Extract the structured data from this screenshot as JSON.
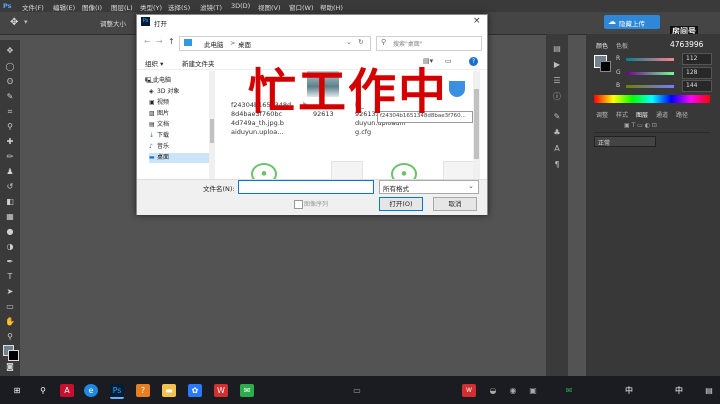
{
  "menu": {
    "items": [
      "Ps",
      "文件(F)",
      "编辑(E)",
      "图像(I)",
      "图层(L)",
      "类型(Y)",
      "选择(S)",
      "滤镜(T)",
      "3D(D)",
      "视图(V)",
      "窗口(W)",
      "帮助(H)"
    ]
  },
  "options": {
    "adjust_label": "调整大小"
  },
  "dialog": {
    "title": "打开",
    "address": {
      "root": "此电脑",
      "sep": ">",
      "folder": "桌面"
    },
    "search_placeholder": "搜索\"桌面\"",
    "organize": "组织",
    "new_folder": "新建文件夹",
    "nav": [
      {
        "icon": "pc",
        "label": "此电脑"
      },
      {
        "icon": "3d",
        "label": "3D 对象"
      },
      {
        "icon": "video",
        "label": "视频"
      },
      {
        "icon": "pic",
        "label": "图片"
      },
      {
        "icon": "doc",
        "label": "文档"
      },
      {
        "icon": "down",
        "label": "下载"
      },
      {
        "icon": "music",
        "label": "音乐"
      },
      {
        "icon": "desk",
        "label": "桌面"
      }
    ],
    "files": [
      {
        "lines": [
          "f24304b1651348d",
          "8d4bae3f760bc",
          "4d749a_th.jpg.b",
          "aiduyun.uploa..."
        ]
      },
      {
        "lines": [
          "b_",
          "92613"
        ]
      },
      {
        "lines": [
          "lv_",
          "92613.mp4.bai",
          "duyun.uploadin",
          "g.cfg"
        ]
      }
    ],
    "tooltip": "f24304b1651348d8bae3f760...",
    "filename_label": "文件名(N):",
    "filetype": "所有格式",
    "open_btn": "打开(O)",
    "cancel_btn": "取消",
    "sequence_label": "图像序列"
  },
  "watermark": "忙工作中",
  "right": {
    "top_btn": "隐藏上传",
    "room_label": "房间号",
    "room_number": "4763996",
    "tabs1": [
      "颜色",
      "色板"
    ],
    "rgb": [
      {
        "ch": "R",
        "value": "112"
      },
      {
        "ch": "G",
        "value": "128"
      },
      {
        "ch": "B",
        "value": "144"
      }
    ],
    "tabs2": [
      "调整",
      "样式",
      "图层",
      "通道",
      "路径"
    ],
    "blend_mode": "正常"
  },
  "taskbar": {
    "ime": "中",
    "ime2": "中"
  },
  "colors": {
    "accent": "#0078d7",
    "watermark": "#d40000",
    "ps_bg": "#535353"
  }
}
